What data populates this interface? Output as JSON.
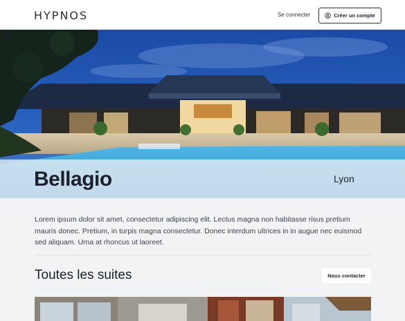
{
  "header": {
    "logo": "HYPNOS",
    "login_label": "Se connecter",
    "signup_label": "Créer un compte",
    "signup_icon": "user-circle-icon"
  },
  "hero": {
    "hotel_name": "Bellagio",
    "city": "Lyon",
    "city_icon": "map-pin-icon"
  },
  "main": {
    "description": "Lorem ipsum dolor sit amet, consectetur adipiscing elit. Lectus magna non habitasse risus pretium mauris donec. Pretium, in turpis magna consectetur. Donec interdum ultrices in in augue nec euismod sed aliquam. Urna at rhoncus ut laoreet.",
    "suites_title": "Toutes les suites",
    "contact_label": "Nous contacter"
  },
  "colors": {
    "text_dark": "#1b202c",
    "body_text": "#3a3f4b",
    "background": "#f2f3f5",
    "sky": "#1f4fa8"
  }
}
